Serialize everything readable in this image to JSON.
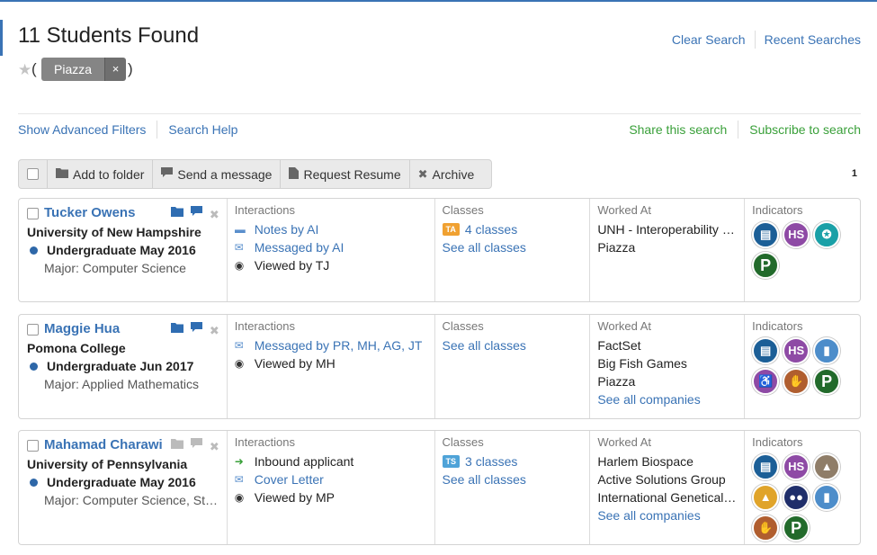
{
  "header": {
    "title": "11 Students Found",
    "star_icon": "star-icon",
    "chip_label": "Piazza",
    "chip_close": "×",
    "paren_open": "(",
    "paren_close": ")",
    "clear_search": "Clear Search",
    "recent_searches": "Recent Searches"
  },
  "filters": {
    "advanced": "Show Advanced Filters",
    "help": "Search Help",
    "share": "Share this search",
    "subscribe": "Subscribe to search"
  },
  "toolbar": {
    "add_folder": "Add to folder",
    "send_message": "Send a message",
    "request_resume": "Request Resume",
    "archive": "Archive",
    "page": "1"
  },
  "column_headers": {
    "interactions": "Interactions",
    "classes": "Classes",
    "worked_at": "Worked At",
    "indicators": "Indicators"
  },
  "students": [
    {
      "name": "Tucker Owens",
      "school": "University of New Hampshire",
      "level": "Undergraduate May 2016",
      "major": "Major: Computer Science",
      "interactions": [
        "Notes by AI",
        "Messaged by AI",
        "Viewed by TJ"
      ],
      "class_badge": "TA",
      "class_count": "4 classes",
      "see_all_classes": "See all classes",
      "worked_at": [
        "UNH - Interoperability Lab",
        "Piazza"
      ],
      "indicators": [
        "document-icon",
        "hs-icon",
        "award-icon",
        "p-icon"
      ]
    },
    {
      "name": "Maggie Hua",
      "school": "Pomona College",
      "level": "Undergraduate Jun 2017",
      "major": "Major: Applied Mathematics",
      "interactions": [
        "Messaged by PR, MH, AG, JT",
        "Viewed by MH"
      ],
      "see_all_classes": "See all classes",
      "worked_at": [
        "FactSet",
        "Big Fish Games",
        "Piazza"
      ],
      "see_all_companies": "See all companies",
      "indicators": [
        "document-icon",
        "hs-icon",
        "id-card-icon",
        "accessibility-icon",
        "handshake-icon",
        "p-icon"
      ]
    },
    {
      "name": "Mahamad Charawi",
      "school": "University of Pennsylvania",
      "level": "Undergraduate May 2016",
      "major": "Major: Computer Science, Statistics",
      "interactions": [
        "Inbound applicant",
        "Cover Letter",
        "Viewed by MP"
      ],
      "class_badge": "TS",
      "class_count": "3 classes",
      "see_all_classes": "See all classes",
      "worked_at": [
        "Harlem Biospace",
        "Active Solutions Group",
        "International Genetically Engineered Machine"
      ],
      "see_all_companies": "See all companies",
      "indicators": [
        "document-icon",
        "hs-icon",
        "grad-hat-icon",
        "grad-hat-icon",
        "group-icon",
        "id-card-icon",
        "handshake-icon",
        "p-icon"
      ]
    }
  ]
}
